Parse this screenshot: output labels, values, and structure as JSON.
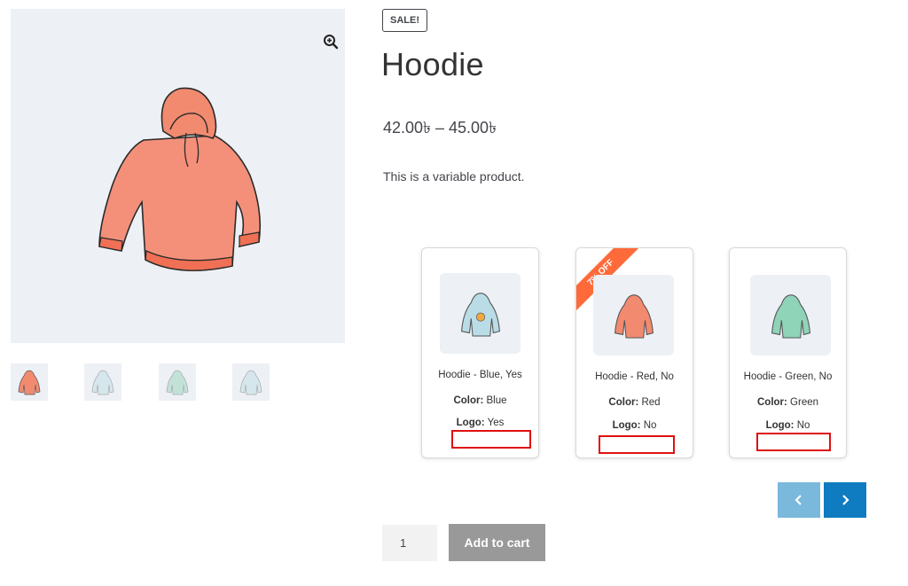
{
  "product": {
    "badge": "SALE!",
    "title": "Hoodie",
    "price": "42.00৳ – 45.00৳",
    "description": "This is a variable product."
  },
  "gallery": {
    "zoom_icon": "zoom-in-icon",
    "thumbnails": [
      {
        "color": "red"
      },
      {
        "color": "blue"
      },
      {
        "color": "green"
      },
      {
        "color": "blue"
      }
    ]
  },
  "variations": [
    {
      "name": "Hoodie - Blue, Yes",
      "color_label": "Color:",
      "color_value": " Blue",
      "logo_label": "Logo:",
      "logo_value": " Yes",
      "ribbon": "",
      "hoodie_color": "#b9dce6"
    },
    {
      "name": "Hoodie - Red, No",
      "color_label": "Color:",
      "color_value": " Red",
      "logo_label": "Logo:",
      "logo_value": " No",
      "ribbon": "7% OFF",
      "hoodie_color": "#f28a70"
    },
    {
      "name": "Hoodie - Green, No",
      "color_label": "Color:",
      "color_value": " Green",
      "logo_label": "Logo:",
      "logo_value": " No",
      "ribbon": "",
      "hoodie_color": "#8fd3b8"
    }
  ],
  "carousel": {
    "prev_icon": "chevron-left-icon",
    "next_icon": "chevron-right-icon"
  },
  "cart": {
    "quantity": "1",
    "add_label": "Add to cart"
  },
  "colors": {
    "accent": "#0f7bc0",
    "accent_light": "#7ab8dc",
    "ribbon": "#ff6a3a",
    "highlight": "#e01010",
    "button_disabled": "#999999"
  }
}
